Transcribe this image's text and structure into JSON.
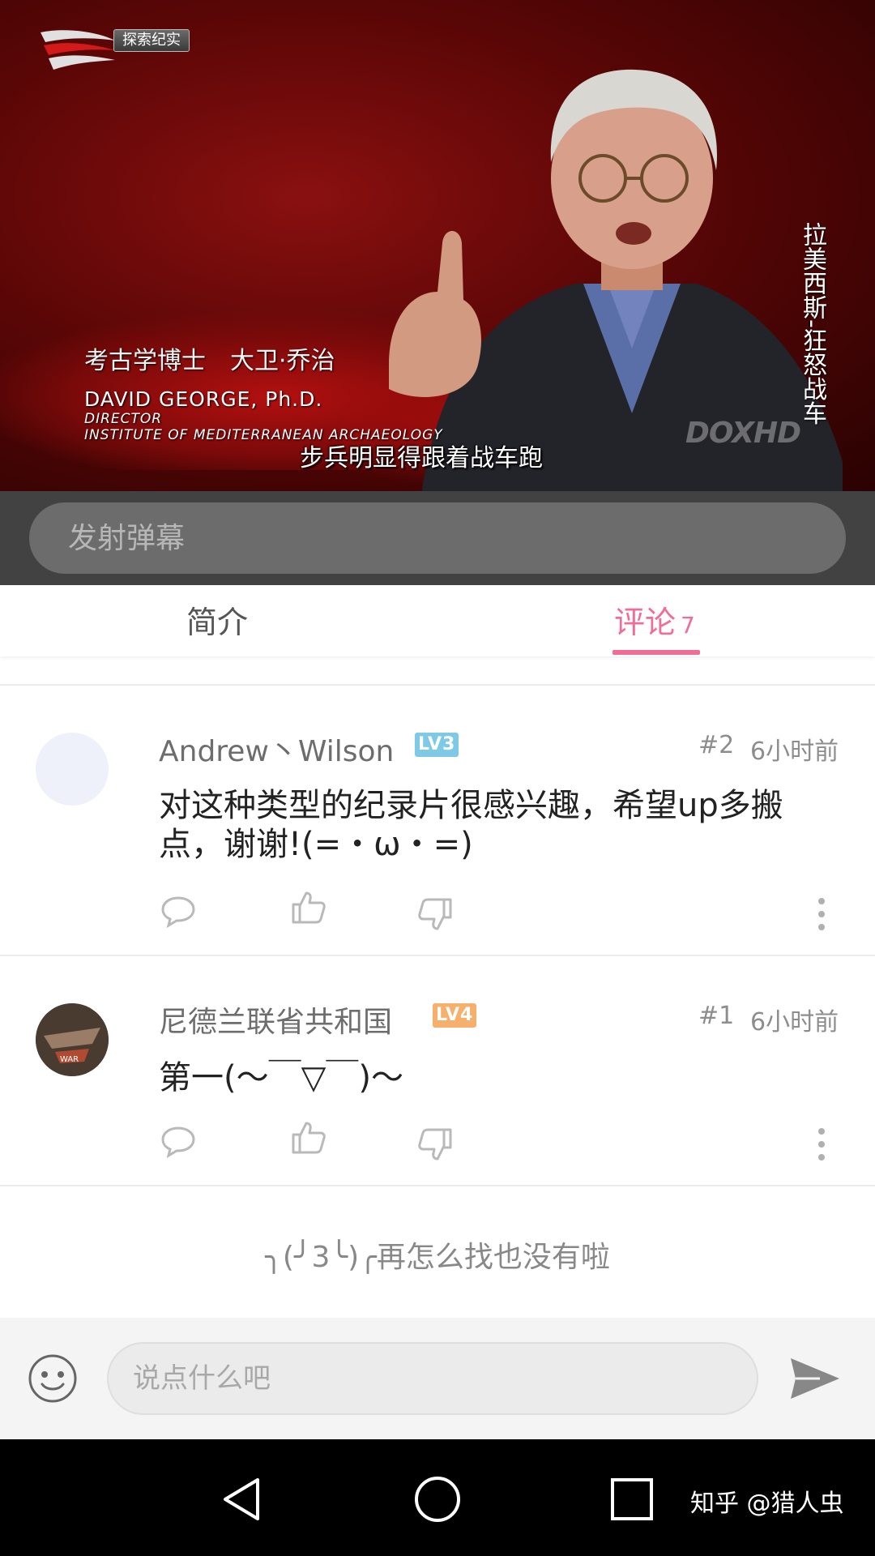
{
  "video": {
    "channel_name": "探索纪实",
    "lower_third": {
      "cn_title": "考古学博士　大卫·乔治",
      "en_name": "DAVID GEORGE, Ph.D.",
      "role1": "DIRECTOR",
      "role2": "INSTITUTE OF MEDITERRANEAN ARCHAEOLOGY"
    },
    "subtitle": "步兵明显得跟着战车跑",
    "watermark": "DOXHD",
    "vertical_title": "拉美西斯-狂怒战车"
  },
  "danmaku": {
    "placeholder": "发射弹幕"
  },
  "tabs": [
    {
      "label": "简介",
      "active": false
    },
    {
      "label": "评论",
      "count": "7",
      "active": true
    }
  ],
  "comments": [
    {
      "username": "Andrew丶Wilson",
      "level": "LV3",
      "floor": "#2",
      "time": "6小时前",
      "content": "对这种类型的纪录片很感兴趣，希望up多搬点，谢谢!(=・ω・=)"
    },
    {
      "username": "尼德兰联省共和国",
      "level": "LV4",
      "floor": "#1",
      "time": "6小时前",
      "content": "第一(～￣▽￣)～"
    }
  ],
  "end_message": "╮(╯3╰)╭再怎么找也没有啦",
  "compose": {
    "placeholder": "说点什么吧"
  },
  "credit": "知乎 @猎人虫",
  "colors": {
    "accent": "#f06d96",
    "lv3": "#7ec9e6",
    "lv4": "#f7b06c"
  }
}
